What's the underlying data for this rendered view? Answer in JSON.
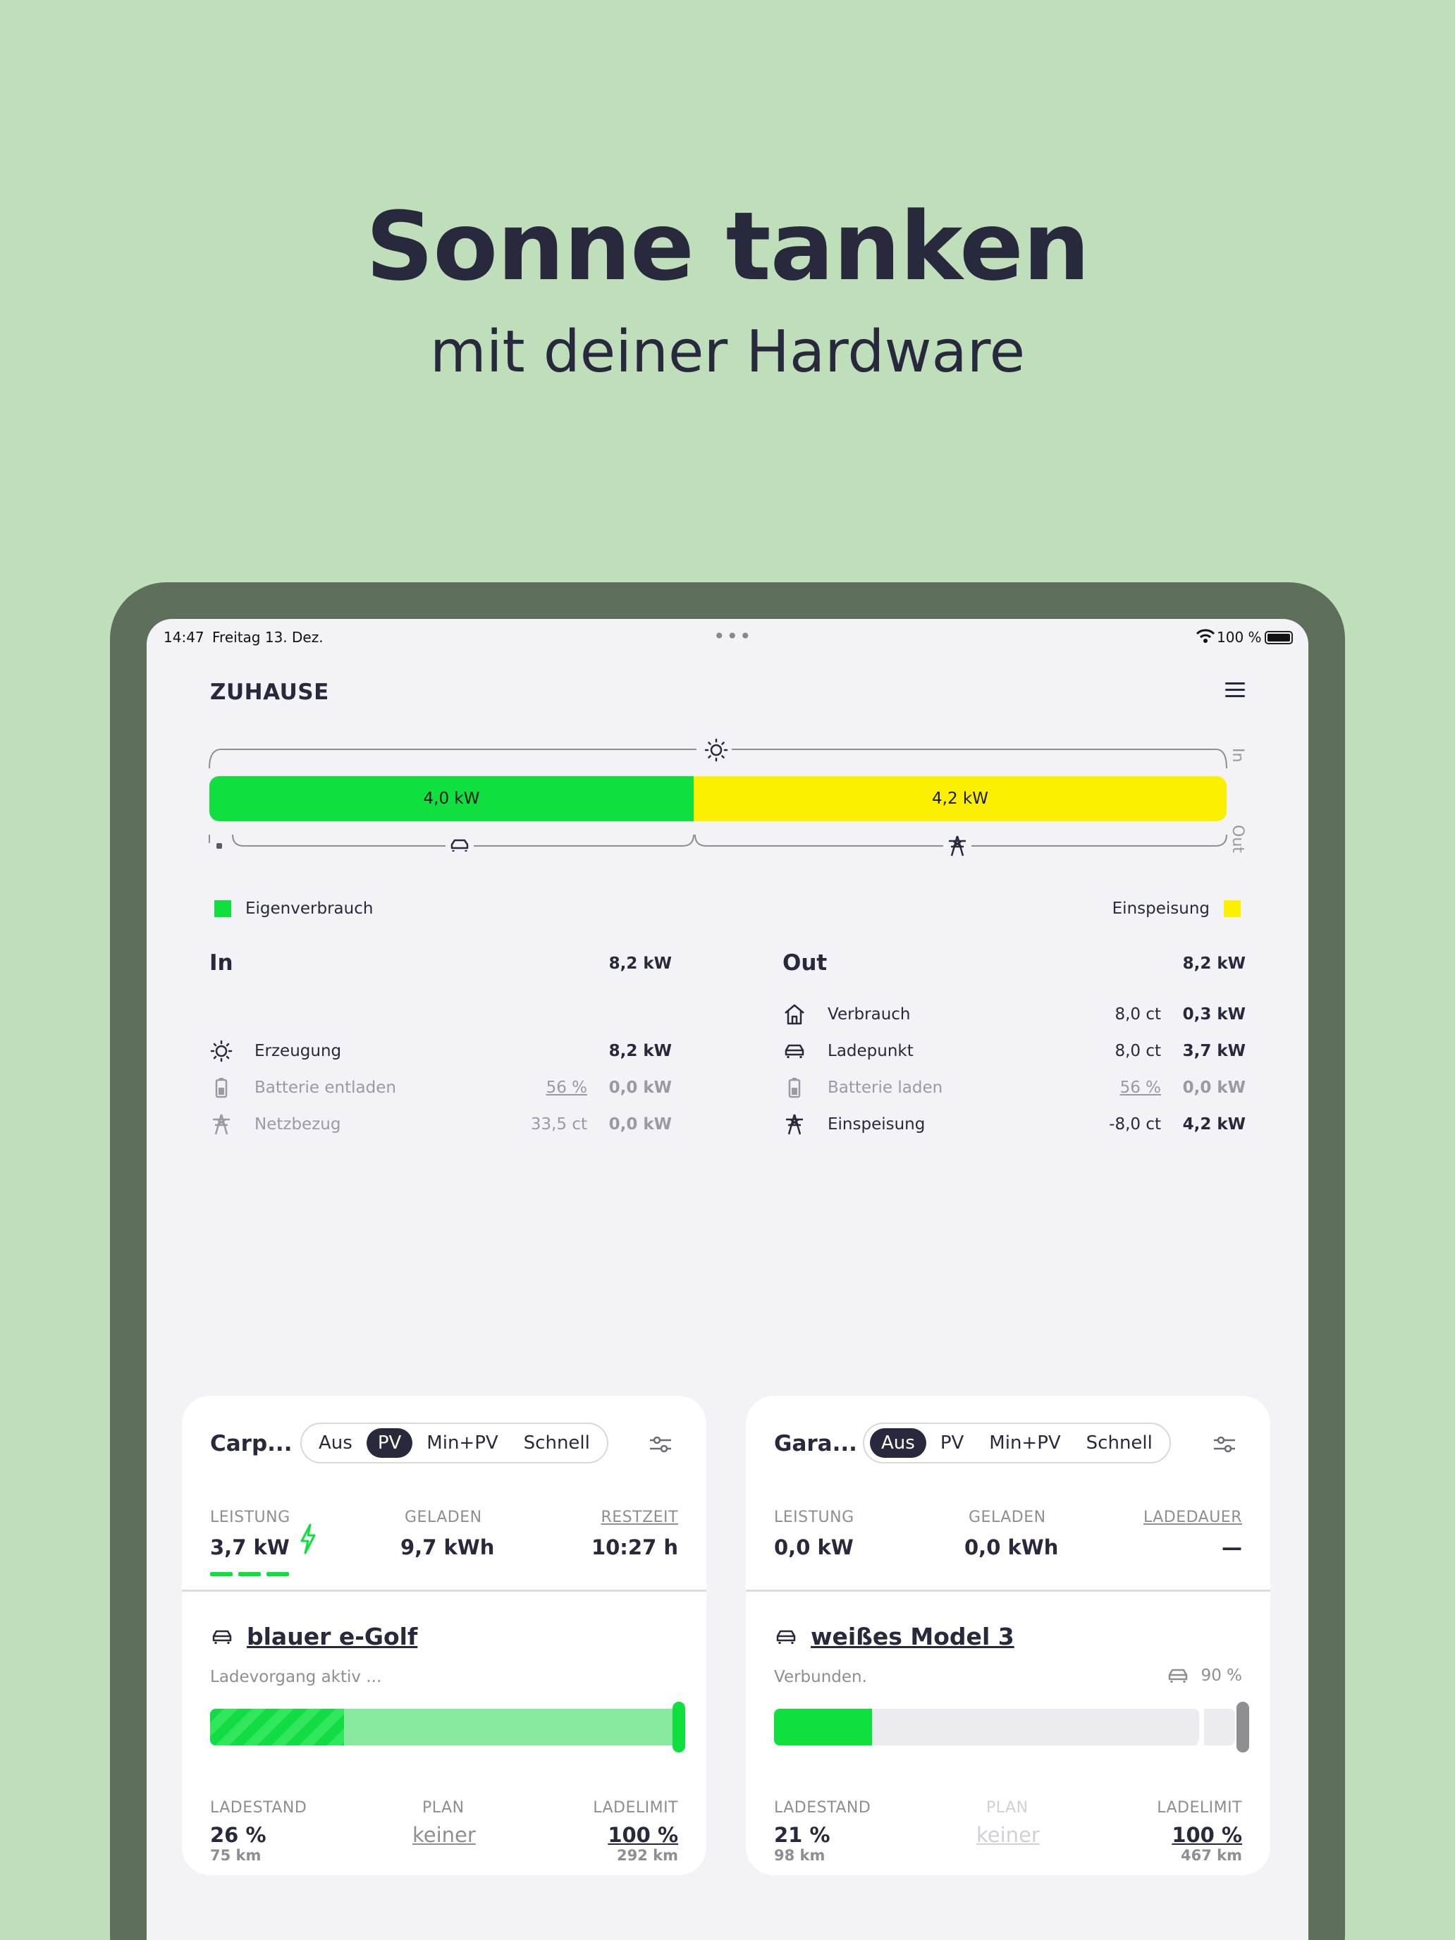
{
  "hero": {
    "title": "Sonne tanken",
    "subtitle": "mit deiner Hardware"
  },
  "statusbar": {
    "time": "14:47",
    "date": "Freitag 13. Dez.",
    "dots": "•••",
    "battery": "100 %"
  },
  "header": {
    "title": "ZUHAUSE"
  },
  "energy_bar": {
    "self_consumption": "4,0 kW",
    "feed_in": "4,2 kW",
    "in_label": "In",
    "out_label": "Out",
    "self_consumption_fraction": 0.488,
    "colors": {
      "self_consumption": "#0fe040",
      "feed_in": "#fbf000"
    }
  },
  "legend": {
    "left": "Eigenverbrauch",
    "right": "Einspeisung"
  },
  "flow_in": {
    "title": "In",
    "total": "8,2 kW",
    "rows": [
      {
        "icon": "sun-icon",
        "label": "Erzeugung",
        "price": "",
        "value": "8,2 kW"
      },
      {
        "icon": "battery-icon",
        "label": "Batterie entladen",
        "price": "56 %",
        "value": "0,0 kW"
      },
      {
        "icon": "power-tower-icon",
        "label": "Netzbezug",
        "price": "33,5 ct",
        "value": "0,0 kW"
      }
    ]
  },
  "flow_out": {
    "title": "Out",
    "total": "8,2 kW",
    "rows": [
      {
        "icon": "house-icon",
        "label": "Verbrauch",
        "price": "8,0 ct",
        "value": "0,3 kW"
      },
      {
        "icon": "car-icon",
        "label": "Ladepunkt",
        "price": "8,0 ct",
        "value": "3,7 kW"
      },
      {
        "icon": "battery-icon",
        "label": "Batterie laden",
        "price": "56 %",
        "value": "0,0 kW"
      },
      {
        "icon": "power-tower-icon",
        "label": "Einspeisung",
        "price": "-8,0 ct",
        "value": "4,2 kW"
      }
    ]
  },
  "loadpoints": [
    {
      "name": "Carp...",
      "modes": [
        "Aus",
        "PV",
        "Min+PV",
        "Schnell"
      ],
      "active_mode": "PV",
      "stats": {
        "power_label": "LEISTUNG",
        "power": "3,7 kW",
        "charged_label": "GELADEN",
        "charged": "9,7 kWh",
        "time_label": "RESTZEIT",
        "time": "10:27 h"
      },
      "vehicle": "blauer e-Golf",
      "status": "Ladevorgang aktiv ...",
      "vehicle_soc": "",
      "soc_fraction": 0.26,
      "limit_fraction": 1.0,
      "bottom": {
        "soc_label": "LADESTAND",
        "soc": "26 %",
        "soc_range": "75 km",
        "plan_label": "PLAN",
        "plan": "keiner",
        "limit_label": "LADELIMIT",
        "limit": "100 %",
        "limit_range": "292 km"
      }
    },
    {
      "name": "Gara...",
      "modes": [
        "Aus",
        "PV",
        "Min+PV",
        "Schnell"
      ],
      "active_mode": "Aus",
      "stats": {
        "power_label": "LEISTUNG",
        "power": "0,0 kW",
        "charged_label": "GELADEN",
        "charged": "0,0 kWh",
        "time_label": "LADEDAUER",
        "time": "—"
      },
      "vehicle": "weißes Model 3",
      "status": "Verbunden.",
      "vehicle_soc": "90 %",
      "soc_fraction": 0.21,
      "limit_fraction": 1.0,
      "bottom": {
        "soc_label": "LADESTAND",
        "soc": "21 %",
        "soc_range": "98 km",
        "plan_label": "PLAN",
        "plan": "keiner",
        "limit_label": "LADELIMIT",
        "limit": "100 %",
        "limit_range": "467 km"
      }
    }
  ]
}
